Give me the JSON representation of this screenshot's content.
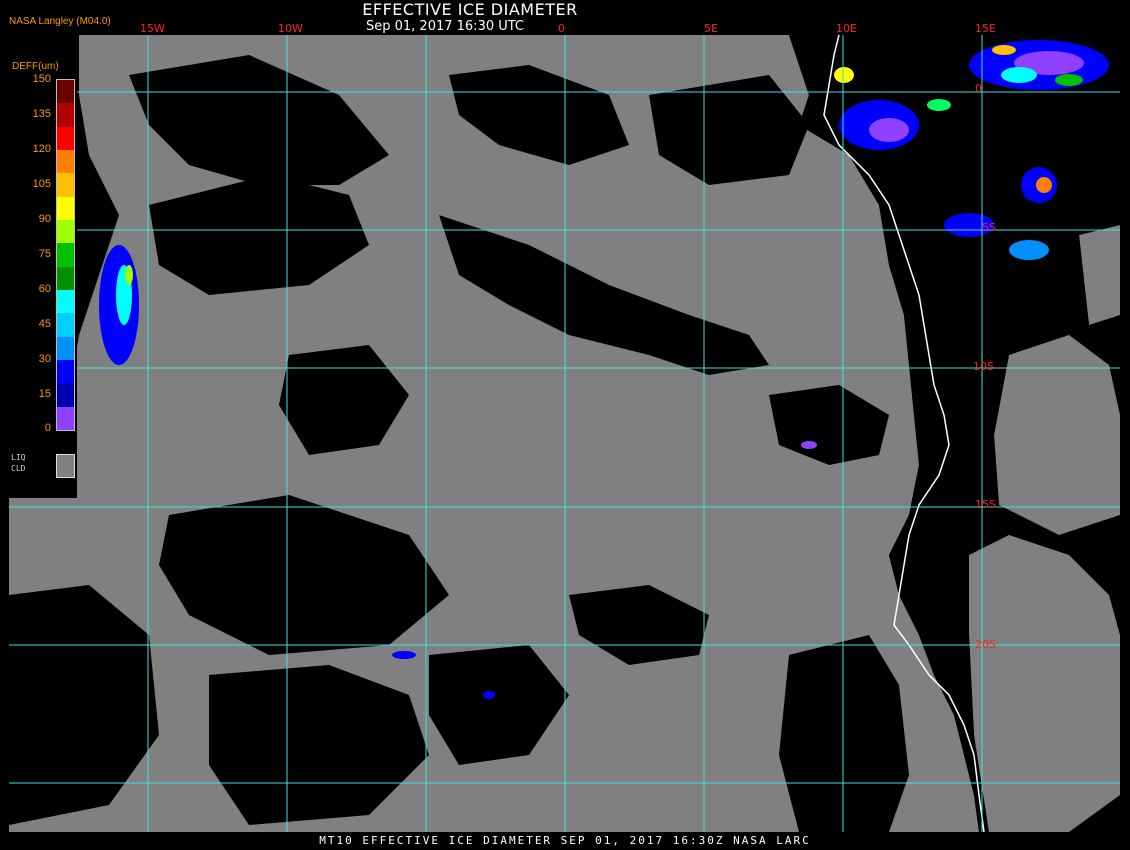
{
  "header": {
    "title": "EFFECTIVE ICE DIAMETER",
    "subtitle": "Sep 01, 2017 16:30 UTC",
    "brand": "NASA Langley (M04.0)"
  },
  "legend": {
    "title": "DEFF(um)",
    "ticks": [
      "150",
      "135",
      "120",
      "105",
      "90",
      "75",
      "60",
      "45",
      "30",
      "15",
      "0"
    ],
    "colors": [
      "#6a0000",
      "#b00000",
      "#ff0000",
      "#ff8000",
      "#ffc000",
      "#ffff00",
      "#a0ff00",
      "#00c000",
      "#009000",
      "#00ffff",
      "#00d0ff",
      "#0090ff",
      "#0000ff",
      "#0000b0",
      "#9040ff"
    ],
    "liq_label_1": "LIQ",
    "liq_label_2": "CLD",
    "liq_color": "#808080"
  },
  "map": {
    "cloud_color": "#808080",
    "grid_color": "#40e0e0",
    "coast_color": "#ffffff",
    "label_color": "#ff2020",
    "lon_labels": [
      "15W",
      "10W",
      "0",
      "5E",
      "10E",
      "15E"
    ],
    "lat_labels": [
      "0",
      "5S",
      "10S",
      "15S",
      "20S"
    ]
  },
  "footer": {
    "text": "MT10  EFFECTIVE ICE DIAMETER  SEP 01, 2017 16:30Z  NASA LARC"
  }
}
